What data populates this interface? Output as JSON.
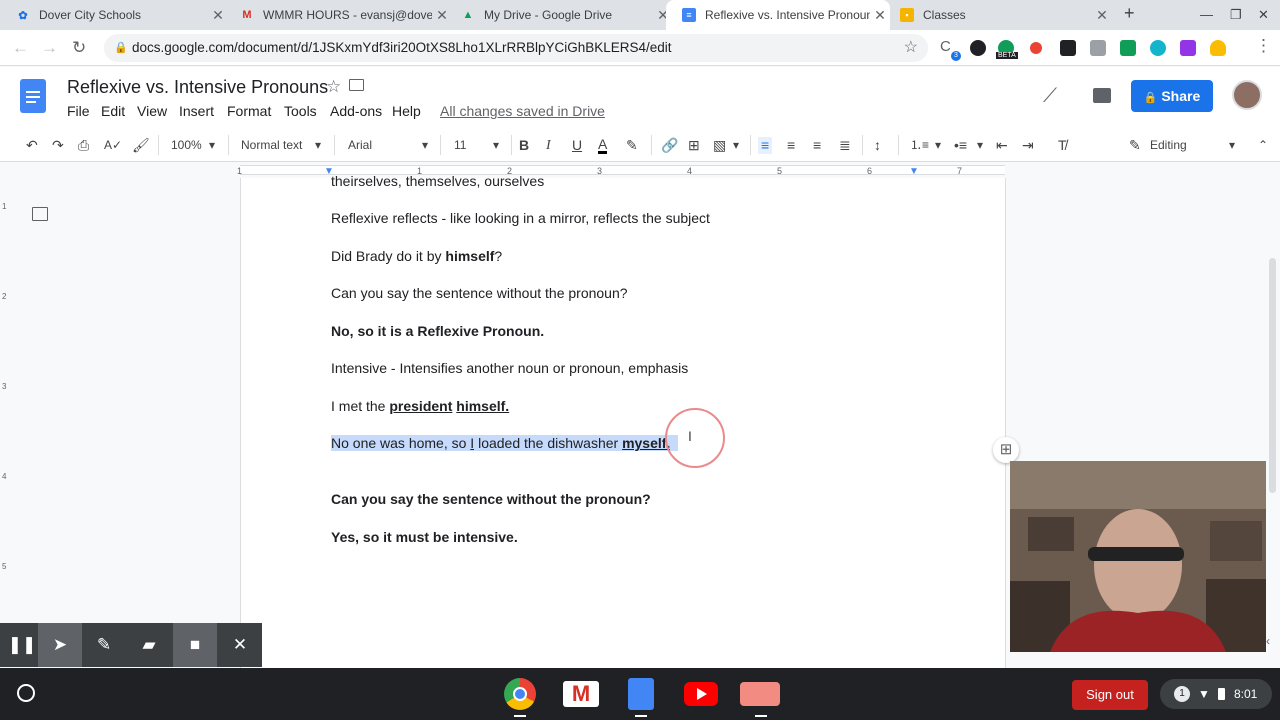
{
  "browser": {
    "tabs": [
      {
        "title": "Dover City Schools",
        "icon": "dover-schools-icon"
      },
      {
        "title": "WMMR HOURS - evansj@dovert",
        "icon": "gmail-icon"
      },
      {
        "title": "My Drive - Google Drive",
        "icon": "drive-icon"
      },
      {
        "title": "Reflexive vs. Intensive Pronouns",
        "icon": "docs-icon"
      },
      {
        "title": "Classes",
        "icon": "classroom-icon"
      }
    ],
    "url": "docs.google.com/document/d/1JSKxmYdf3iri20OtXS8Lho1XLrRRBlpYCiGhBKLERS4/edit",
    "new_tab_label": "+",
    "ext_badge": "3",
    "beta_badge": "BETA"
  },
  "docs": {
    "title": "Reflexive vs. Intensive Pronouns",
    "menus": [
      "File",
      "Edit",
      "View",
      "Insert",
      "Format",
      "Tools",
      "Add-ons",
      "Help"
    ],
    "save_status": "All changes saved in Drive",
    "share_label": "Share"
  },
  "toolbar": {
    "zoom": "100%",
    "style": "Normal text",
    "font": "Arial",
    "font_size": "11",
    "mode": "Editing"
  },
  "ruler": {
    "numbers": [
      "1",
      "1",
      "2",
      "3",
      "4",
      "5",
      "6",
      "7"
    ]
  },
  "document": {
    "line0": "theirselves, themselves, ourselves",
    "line1": "Reflexive reflects - like looking in a mirror, reflects the subject",
    "line2_pre": "Did Brady do it by ",
    "line2_bold": "himself",
    "line2_post": "?",
    "line3": "Can you say the sentence without the pronoun?",
    "line4": "No, so it is a Reflexive Pronoun.",
    "line5": "Intensive - Intensifies another noun or pronoun, emphasis",
    "line6_pre": "I met the ",
    "line6_b1": "president",
    "line6_b2": "himself.",
    "line7_a": "No one was home, so ",
    "line7_i": " I",
    "line7_b": " loaded the dishwasher ",
    "line7_c": "myself.",
    "line8": "Can you say the sentence without the pronoun?",
    "line9": "Yes, so it must be intensive."
  },
  "shelf": {
    "signout_label": "Sign out",
    "notification_count": "1",
    "time": "8:01"
  }
}
